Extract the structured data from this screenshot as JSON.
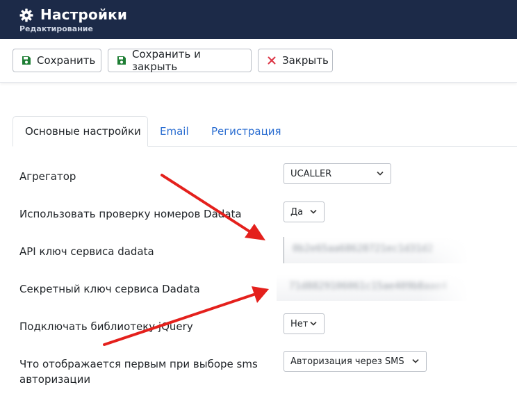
{
  "header": {
    "title": "Настройки",
    "subtitle": "Редактирование",
    "icon": "gear-icon"
  },
  "toolbar": {
    "save_label": "Сохранить",
    "save_close_label": "Сохранить и закрыть",
    "close_label": "Закрыть"
  },
  "tabs": [
    {
      "label": "Основные настройки",
      "active": true
    },
    {
      "label": "Email",
      "active": false
    },
    {
      "label": "Регистрация",
      "active": false
    }
  ],
  "form": {
    "aggregator": {
      "label": "Агрегатор",
      "value": "UCALLER"
    },
    "dadata_check": {
      "label": "Использовать проверку номеров Dadata",
      "value": "Да"
    },
    "api_key": {
      "label": "API ключ сервиса dadata",
      "value": "0b2e65aa68628721ec1d31d2"
    },
    "secret_key": {
      "label": "Секретный ключ сервиса Dadata",
      "value": "71d8829106061c15ae409b8aae4"
    },
    "jquery": {
      "label": "Подключать библиотеку jQuery",
      "value": "Нет"
    },
    "sms_first": {
      "label": "Что отображается первым при выборе sms авторизации",
      "value": "Авторизация через SMS"
    }
  },
  "colors": {
    "header_bg": "#1c2a48",
    "save_icon": "#1e7e34",
    "close_icon": "#dc3545",
    "tab_link": "#2a6dd1",
    "arrow": "#e4201c"
  }
}
